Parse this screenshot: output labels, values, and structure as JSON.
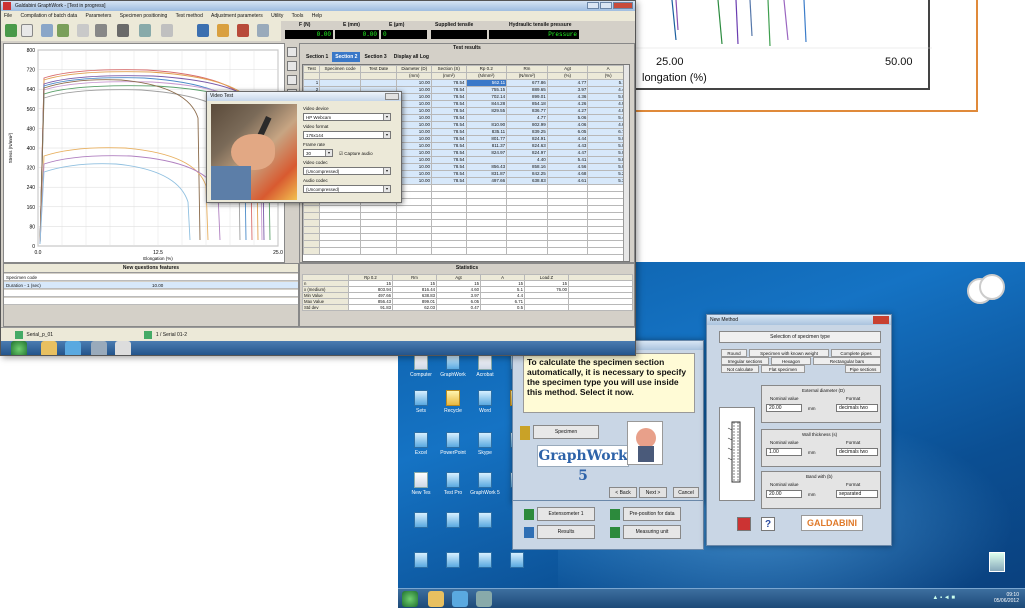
{
  "back_window": {
    "tick_25": "25.00",
    "tick_50": "50.00",
    "xlabel": "longation (%)"
  },
  "app": {
    "title": "Galdabini GraphWork - [Test in progress]",
    "menu": [
      "File",
      "Compilation of batch data",
      "Parameters",
      "Specimen positioning",
      "Test method",
      "Adjustment parameters",
      "Utility",
      "Tools",
      "Help"
    ],
    "readouts": [
      {
        "label": "F (N)",
        "value": "0.00"
      },
      {
        "label": "E (mm)",
        "value": "0.00"
      },
      {
        "label": "E (µm)",
        "value": "0"
      },
      {
        "label": "Supplied tensile",
        "value": ""
      },
      {
        "label": "Hydraulic tensile pressure",
        "value": "Pressure"
      }
    ],
    "chart": {
      "ylabel": "Stress (N/mm²)",
      "xlabel": "Elongation (%)",
      "x_tick_labels": [
        "0.0",
        "12.5",
        "25.0"
      ],
      "y_tick_labels": [
        "800",
        "720",
        "640",
        "560",
        "480",
        "400",
        "320",
        "240",
        "160",
        "80",
        "0"
      ]
    },
    "results": {
      "title": "Test results",
      "tabs": [
        {
          "label": "Section 1",
          "active": false
        },
        {
          "label": "Section 2",
          "active": true
        },
        {
          "label": "Section 3",
          "active": false
        },
        {
          "label": "Display all Log",
          "active": false
        }
      ],
      "columns": [
        "Test",
        "Specimen code",
        "Test Date",
        "Diameter (D)",
        "Section (S)",
        "Rp 0.2",
        "Rm",
        "Agt",
        "A"
      ],
      "units": [
        "",
        "",
        "",
        "(mm)",
        "(mm²)",
        "(N/mm²)",
        "(N/mm²)",
        "(%)",
        "(%)"
      ],
      "rows": [
        [
          "1",
          "",
          "",
          "10.00",
          "78.54",
          "562.11",
          "677.86",
          "4.77",
          "5.11"
        ],
        [
          "2",
          "",
          "",
          "10.00",
          "78.54",
          "755.15",
          "889.65",
          "3.97",
          "4.40"
        ],
        [
          "3",
          "",
          "",
          "10.00",
          "78.54",
          "702.14",
          "899.01",
          "4.36",
          "5.02"
        ],
        [
          "4",
          "",
          "",
          "10.00",
          "78.54",
          "844.28",
          "854.18",
          "4.26",
          "4.93"
        ],
        [
          "5",
          "",
          "",
          "10.00",
          "78.54",
          "829.55",
          "836.77",
          "4.27",
          "4.81"
        ],
        [
          "6",
          "",
          "",
          "10.00",
          "78.54",
          "",
          "4.77",
          "5.06",
          "5.42"
        ],
        [
          "7",
          "",
          "",
          "10.00",
          "78.54",
          "810.90",
          "802.99",
          "4.06",
          "4.66"
        ],
        [
          "8",
          "",
          "",
          "10.00",
          "78.54",
          "835.11",
          "839.25",
          "6.05",
          "6.71"
        ],
        [
          "9",
          "",
          "",
          "10.00",
          "78.54",
          "801.77",
          "824.91",
          "4.44",
          "5.01"
        ],
        [
          "10",
          "",
          "",
          "10.00",
          "78.54",
          "811.37",
          "824.63",
          "4.43",
          "5.06"
        ],
        [
          "11",
          "",
          "",
          "10.00",
          "78.54",
          "824.97",
          "824.97",
          "4.47",
          "5.02"
        ],
        [
          "12",
          "",
          "",
          "10.00",
          "78.54",
          "",
          "4.40",
          "5.41",
          "5.88"
        ],
        [
          "13",
          "",
          "",
          "10.00",
          "78.54",
          "856.43",
          "858.16",
          "4.56",
          "5.08"
        ],
        [
          "14",
          "",
          "",
          "10.00",
          "78.54",
          "831.87",
          "842.25",
          "4.68",
          "5.21"
        ],
        [
          "15",
          "",
          "",
          "10.00",
          "78.54",
          "497.66",
          "638.83",
          "4.61",
          "5.31"
        ]
      ]
    },
    "video": {
      "title": "Video Test",
      "device_label": "Video device",
      "device_value": "HP Webcam",
      "size_label": "Video format",
      "size_value": "176x144",
      "fps_label": "Frame rate",
      "fps_value": "30",
      "capture_label": "Capture audio",
      "comp_label": "Video codec",
      "comp_value": "(Uncompressed)",
      "audio_label": "Audio codec",
      "audio_value": "(Uncompressed)"
    },
    "analysis": {
      "title": "New questions features",
      "rows": [
        {
          "label": "Specimen code",
          "value": ""
        },
        {
          "label": "Duration - 1 (sec)",
          "value": "10.00"
        },
        {
          "label": "",
          "value": ""
        },
        {
          "label": "",
          "value": ""
        }
      ]
    },
    "statistics": {
      "title": "Statistics",
      "columns": [
        "",
        "Rp 0.2",
        "Rm",
        "Agt",
        "A",
        "Load Z"
      ],
      "rows": [
        [
          "n",
          "15",
          "15",
          "15",
          "15",
          "15"
        ],
        [
          "x (medium)",
          "803.94",
          "816.44",
          "4.60",
          "5.1",
          "76.00"
        ],
        [
          "Min Value",
          "497.66",
          "638.83",
          "3.97",
          "4.4",
          ""
        ],
        [
          "Max Value",
          "856.43",
          "899.01",
          "6.05",
          "6.71",
          ""
        ],
        [
          "Std dev",
          "91.83",
          "62.03",
          "0.47",
          "0.5",
          ""
        ]
      ]
    },
    "status": {
      "left": "Serial_p_01",
      "right": "1 / Serial 01-2"
    }
  },
  "wizard": {
    "message": "To calculate the specimen section automatically, it is necessary to specify the specimen type you will use inside this method. Select it now.",
    "specimen_button": "Specimen",
    "logo_text": "GraphWork 5",
    "back": "< Back",
    "next": "Next >",
    "cancel": "Cancel",
    "lower_buttons": [
      "Extensometer 1",
      "Pre-position for data",
      "Results",
      "Measuring unit"
    ]
  },
  "new_method": {
    "title": "New Method",
    "heading": "Selection of specimen type",
    "tabs": [
      "Round",
      "Specimen with known weight",
      "Complete pipes",
      "Irregular sections",
      "Hexagon",
      "Rectangular bars",
      "Not calculate",
      "Flat specimen",
      "Pipe sections"
    ],
    "group1_title": "External diameter (D)",
    "group2_title": "Wall thickness (s)",
    "group3_title": "Band with (b)",
    "nominal_label": "Nominal value",
    "format_label": "Format",
    "values": [
      "20.00",
      "1.00",
      "20.00"
    ],
    "units": [
      "mm",
      "mm",
      "mm"
    ],
    "formats": [
      "decimals two",
      "decimals two",
      "separated"
    ],
    "brand": "GALDABINI"
  },
  "desktop": {
    "icons": [
      "Computer",
      "GraphWork",
      "Acrobat",
      "Sets",
      "Recycle",
      "Word",
      "Excel",
      "PowerPoint",
      "Skype",
      "New Tes",
      "Test Pro",
      "GraphWork 5"
    ],
    "clock_time": "09:10",
    "clock_date": "05/06/2012"
  }
}
